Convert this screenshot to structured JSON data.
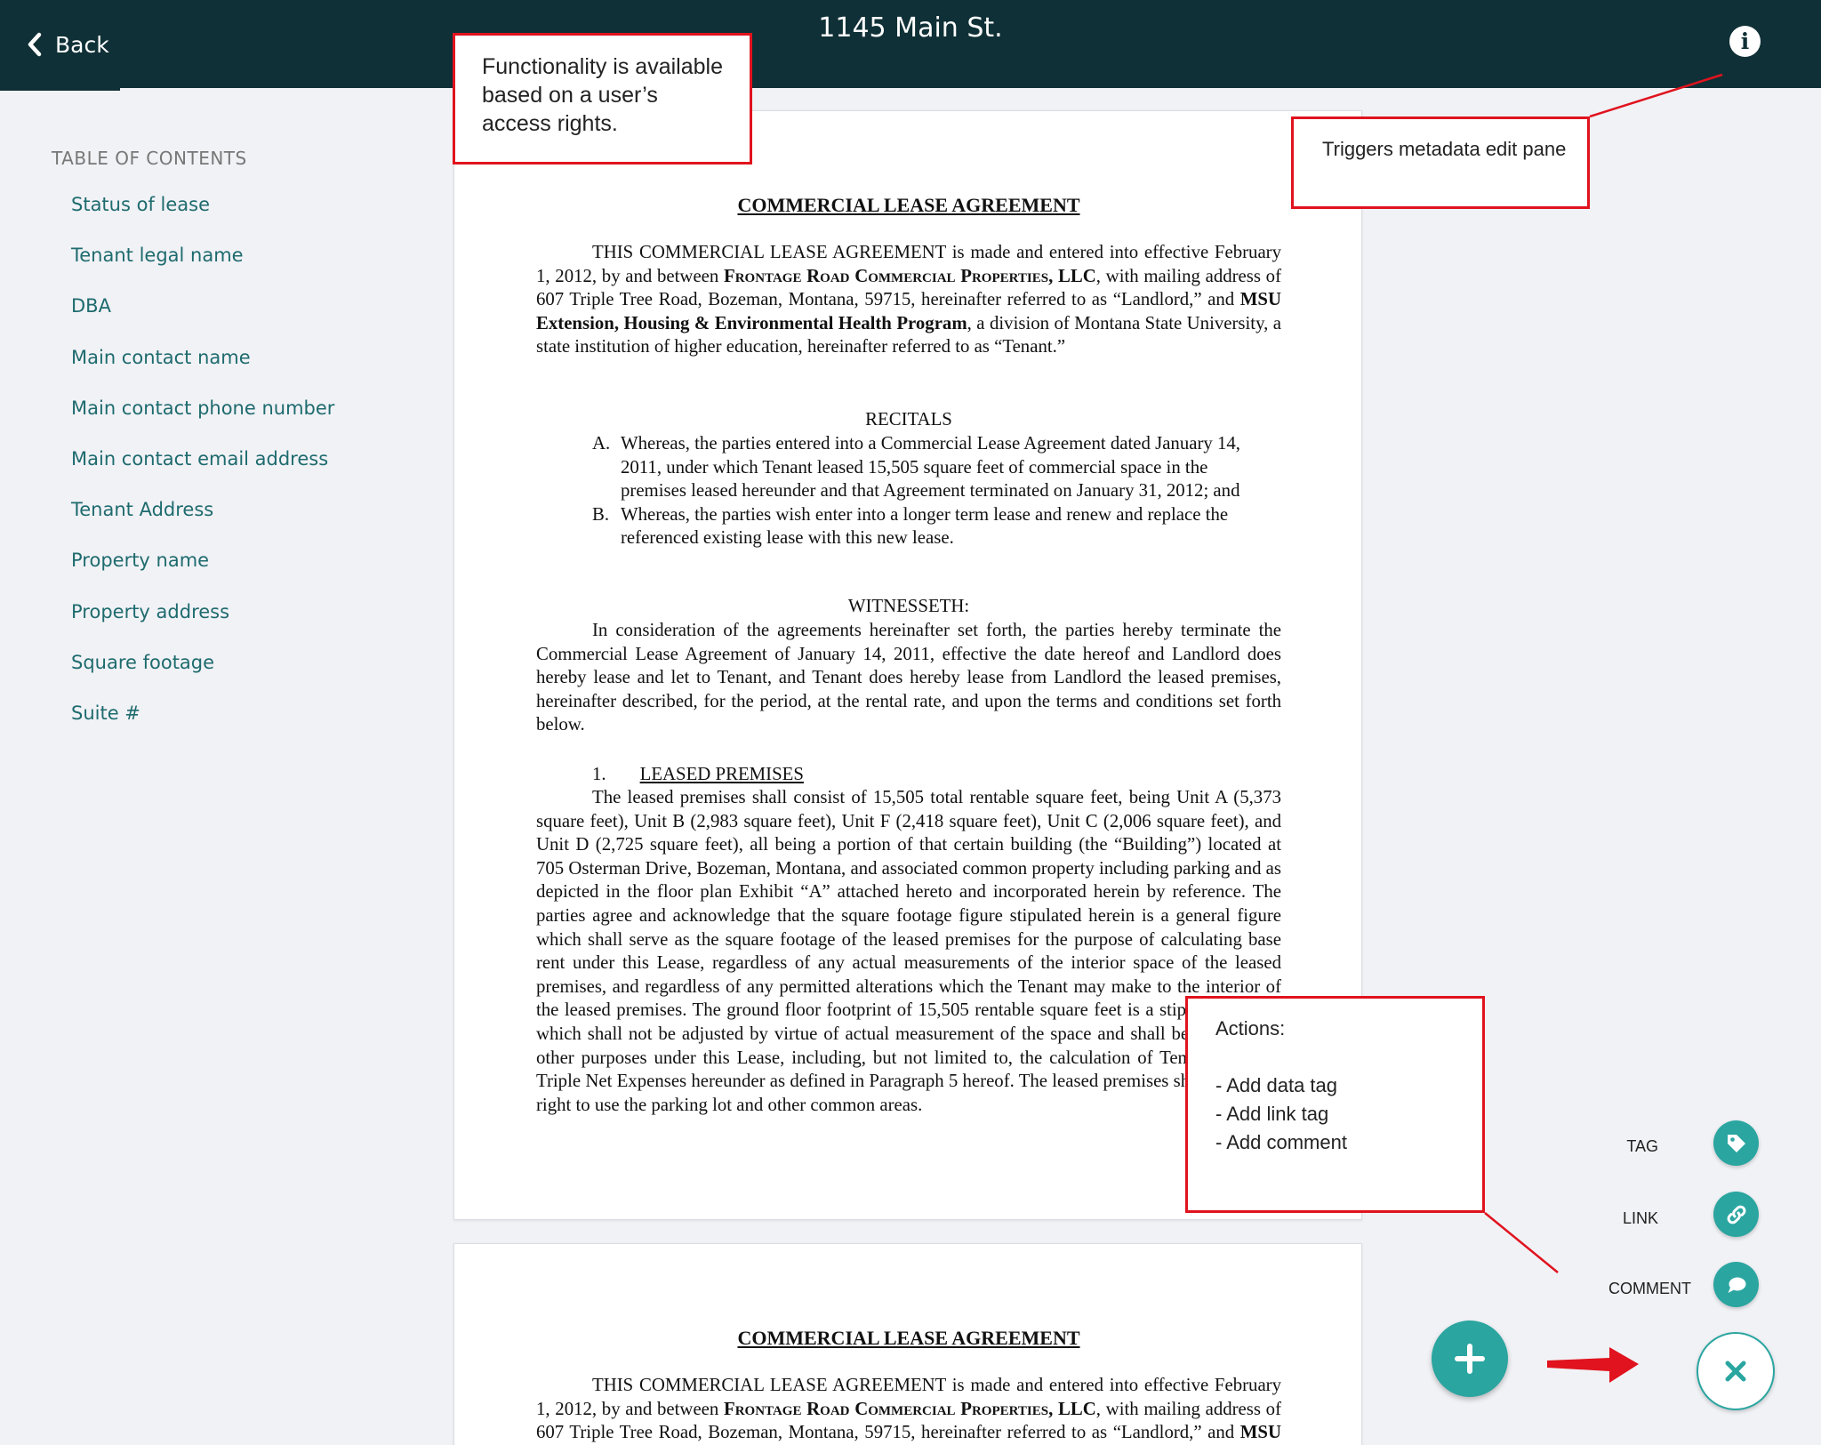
{
  "header": {
    "back_label": "Back",
    "title": "1145 Main St."
  },
  "toc": {
    "heading": "TABLE OF CONTENTS",
    "items": [
      "Status of lease",
      "Tenant legal name",
      "DBA",
      "Main contact name",
      "Main contact phone number",
      "Main contact email address",
      "Tenant Address",
      "Property name",
      "Property address",
      "Square footage",
      "Suite #"
    ]
  },
  "document": {
    "title": "COMMERCIAL LEASE AGREEMENT",
    "intro": {
      "p1": "THIS COMMERCIAL LEASE AGREEMENT is made and entered into effective February 1, 2012, by and between ",
      "landlord_name": "Frontage Road Commercial Properties, LLC",
      "p2": ", with mailing address of 607 Triple Tree Road, Bozeman, Montana, 59715, hereinafter referred to as “Landlord,” and ",
      "tenant_name": "MSU Extension, Housing & Environmental Health Program",
      "p3": ", a division of Montana State University, a state institution of higher education, hereinafter referred to as “Tenant.”"
    },
    "recitals_heading": "RECITALS",
    "recitals": [
      {
        "label": "A.",
        "text": "Whereas, the parties entered into a Commercial Lease Agreement dated January 14, 2011, under which Tenant leased 15,505 square feet of commercial space in the premises leased hereunder and that Agreement terminated on January 31, 2012; and"
      },
      {
        "label": "B.",
        "text": "Whereas, the parties wish enter into a longer term lease and renew and replace the referenced existing lease with this new lease."
      }
    ],
    "witnesseth_heading": "WITNESSETH:",
    "witnesseth_text": "In consideration of the agreements hereinafter set forth, the parties hereby terminate the Commercial Lease Agreement of January 14, 2011, effective the date hereof and Landlord does hereby lease and let to Tenant, and Tenant does hereby lease from Landlord the leased premises, hereinafter described, for the period, at the rental rate, and upon the terms and conditions set forth below.",
    "section1_number": "1.",
    "section1_heading": "LEASED PREMISES",
    "section1_text": "The leased premises shall consist of 15,505 total rentable square feet, being Unit A (5,373 square feet), Unit B (2,983 square feet), Unit F (2,418 square feet), Unit C (2,006 square feet), and Unit D (2,725 square feet), all being a portion of that certain building (the “Building”) located at 705 Osterman Drive, Bozeman, Montana, and associated common property including parking and as depicted in the floor plan Exhibit “A” attached hereto and incorporated herein by reference. The parties agree and acknowledge that the square footage figure stipulated herein is a general figure which shall serve as the square footage of the leased premises for the purpose of calculating base rent under this Lease, regardless of any actual measurements of the interior space of the leased premises, and regardless of any permitted alterations which the Tenant may make to the interior of the leased premises. The ground floor footprint of 15,505 rentable square feet is a stipulated figure which shall not be adjusted by virtue of actual measurement of the space and shall be used for all other purposes under this Lease, including, but not limited to, the calculation of Tenant’s prorata Triple Net Expenses hereunder as defined in Paragraph 5 hereof. The leased premises shall enjoy the right to use the parking lot and other common areas."
  },
  "callouts": {
    "access": "Functionality is available based on a user’s access rights.",
    "metadata": "Triggers metadata edit pane",
    "actions_title": "Actions:",
    "actions_items": [
      "- Add data tag",
      "- Add link tag",
      "- Add comment"
    ]
  },
  "fab_menu": {
    "tag_label": "TAG",
    "link_label": "LINK",
    "comment_label": "COMMENT",
    "icons": {
      "tag": "tag-icon",
      "link": "link-icon",
      "comment": "comment-icon",
      "add": "plus-icon",
      "close": "close-icon"
    }
  },
  "colors": {
    "header_bg": "#0f3036",
    "accent_teal": "#2aa5a0",
    "toc_link": "#1e6b6e",
    "callout_red": "#e0131e"
  }
}
